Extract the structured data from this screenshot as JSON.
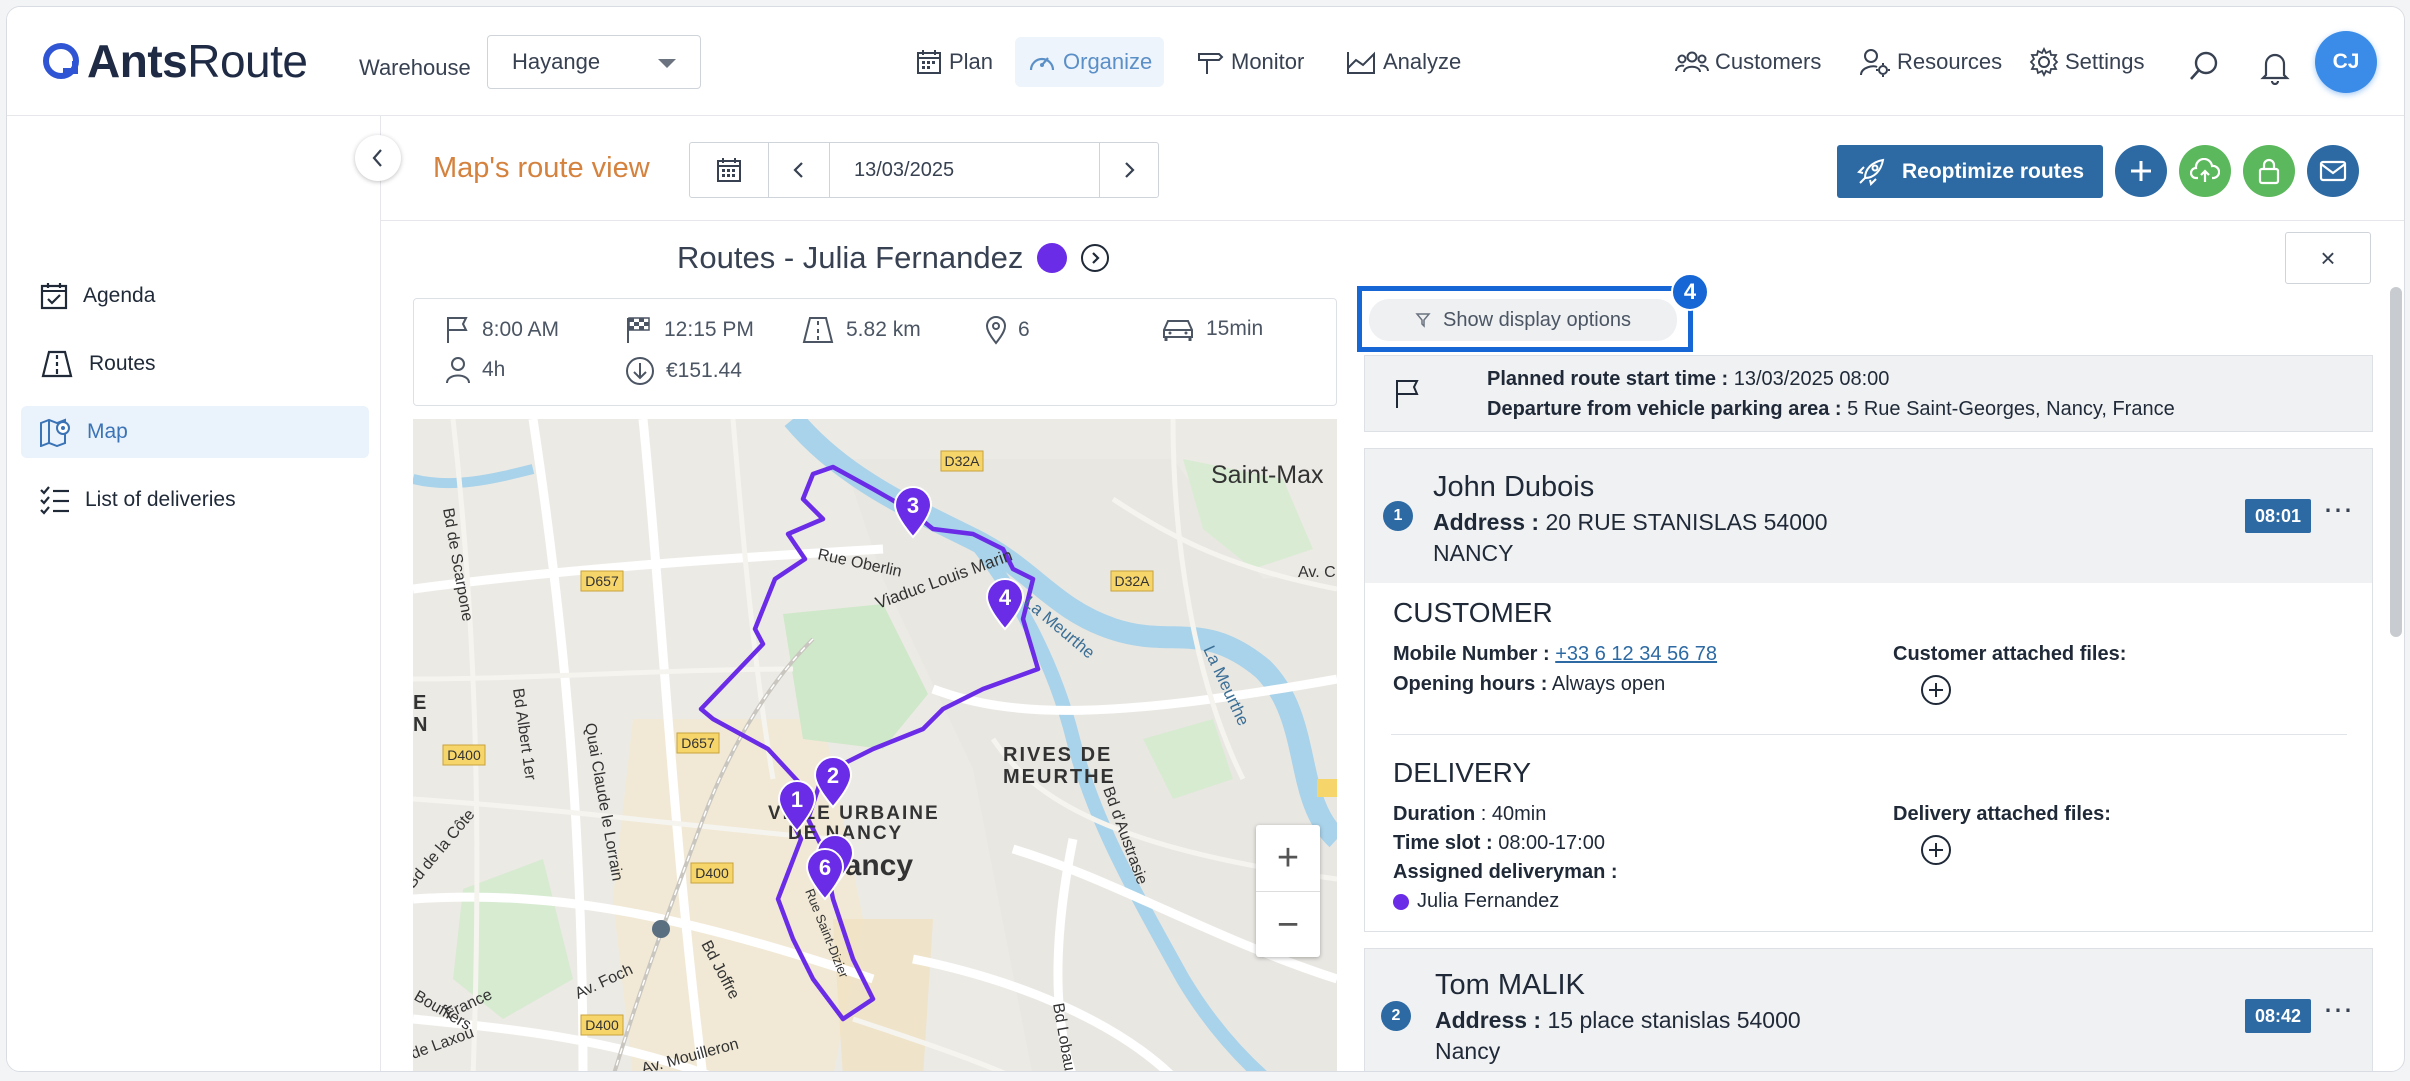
{
  "brand": {
    "logo_text_bold": "Ants",
    "logo_text_regular": "Route"
  },
  "header": {
    "warehouse_label": "Warehouse",
    "warehouse_value": "Hayange",
    "nav": {
      "plan": "Plan",
      "organize": "Organize",
      "monitor": "Monitor",
      "analyze": "Analyze"
    },
    "right_nav": {
      "customers": "Customers",
      "resources": "Resources",
      "settings": "Settings"
    },
    "avatar_initials": "CJ"
  },
  "sidebar": {
    "items": [
      {
        "label": "Agenda",
        "icon": "calendar-check-icon"
      },
      {
        "label": "Routes",
        "icon": "routes-icon"
      },
      {
        "label": "Map",
        "icon": "map-icon",
        "active": true
      },
      {
        "label": "List of deliveries",
        "icon": "list-icon"
      }
    ]
  },
  "toolbar": {
    "page_title": "Map's route view",
    "date": "13/03/2025",
    "reoptimize_label": "Reoptimize routes"
  },
  "route": {
    "title": "Routes - Julia Fernandez",
    "color": "#6a2ce6",
    "stats": {
      "start_time": "8:00 AM",
      "end_time": "12:15 PM",
      "distance": "5.82 km",
      "stops": "6",
      "drive_time": "15min",
      "duration": "4h",
      "cost": "€151.44"
    }
  },
  "map": {
    "labels": {
      "saint_max": "Saint-Max",
      "rives_1": "RIVES DE",
      "rives_2": "MEURTHE",
      "ville_1": "VILLE URBAINE",
      "ville_2": "DE NANCY",
      "nancy": "Nancy",
      "d32a_1": "D32A",
      "d32a_2": "D32A",
      "d657_1": "D657",
      "d657_2": "D657",
      "d400_1": "D400",
      "d400_2": "D400",
      "d400_3": "D400",
      "rue_oberlin": "Rue Oberlin",
      "viaduc": "Viaduc Louis Marin",
      "la_meurthe_1": "La Meurthe",
      "la_meurthe_2": "La Meurthe",
      "bd_scarpone": "Bd de Scarpone",
      "bd_albert": "Bd Albert 1er",
      "quai_claude": "Quai Claude le Lorrain",
      "bd_austrasie": "Bd d'Austrasie",
      "bd_jaffe": "Bd Joffre",
      "av_foch": "Av. Foch",
      "av_mouilleron": "Av. Mouilleron",
      "bd_cote": "Bd de la Côte",
      "bouffiers": "Bouffiers",
      "france": "France",
      "laxou": "de Laxou",
      "rue_saint_dizier": "Rue Saint-Dizier",
      "bd_lobau": "Bd Lobau"
    },
    "markers": [
      "1",
      "2",
      "3",
      "4",
      "6"
    ],
    "zoom_in": "+",
    "zoom_out": "−"
  },
  "panel": {
    "display_options_label": "Show display options",
    "step_badge": "4",
    "close": "×",
    "planned_start_label": "Planned route start time :",
    "planned_start_value": "13/03/2025 08:00",
    "departure_label": "Departure from vehicle parking area :",
    "departure_value": "5 Rue Saint-Georges, Nancy, France",
    "stops": [
      {
        "number": "1",
        "name": "John Dubois",
        "address_label": "Address :",
        "address_line1": "20 RUE STANISLAS 54000",
        "address_line2": "NANCY",
        "time": "08:01",
        "customer_title": "CUSTOMER",
        "mobile_label": "Mobile Number :",
        "mobile_value": "+33 6 12 34 56 78",
        "hours_label": "Opening hours :",
        "hours_value": "Always open",
        "customer_files_label": "Customer attached files:",
        "delivery_title": "DELIVERY",
        "duration_label": "Duration",
        "duration_value": ": 40min",
        "slot_label": "Time slot :",
        "slot_value": "08:00-17:00",
        "assigned_label": "Assigned deliveryman :",
        "assigned_value": "Julia Fernandez",
        "delivery_files_label": "Delivery attached files:"
      },
      {
        "number": "2",
        "name": "Tom MALIK",
        "address_label": "Address :",
        "address_line1": "15 place stanislas 54000",
        "address_line2": "Nancy",
        "time": "08:42"
      }
    ]
  },
  "colors": {
    "accent": "#2d6aa3",
    "title_orange": "#d4823e",
    "route_purple": "#6a2ce6",
    "highlight": "#1766d6"
  }
}
